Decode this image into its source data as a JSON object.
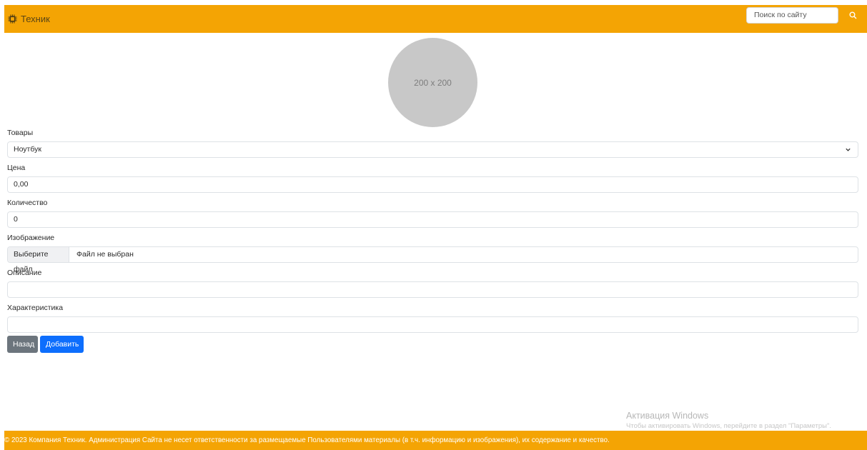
{
  "navbar": {
    "brand_label": "Техник",
    "search_placeholder": "Поиск по сайту",
    "accent_color": "#f4a404"
  },
  "avatar": {
    "placeholder_text": "200 x 200"
  },
  "form": {
    "products_label": "Товары",
    "products_value": "Ноутбук",
    "price_label": "Цена",
    "price_value": "0,00",
    "quantity_label": "Количество",
    "quantity_value": "0",
    "image_label": "Изображение",
    "file_button_label": "Выберите файл",
    "file_status": "Файл не выбран",
    "description_label": "Описание",
    "description_value": "",
    "specs_label": "Характеристика",
    "specs_value": ""
  },
  "actions": {
    "back_label": "Назад",
    "add_label": "Добавить"
  },
  "watermark": {
    "title": "Активация Windows",
    "subtitle": "Чтобы активировать Windows, перейдите в раздел \"Параметры\"."
  },
  "footer": {
    "text": "© 2023 Компания Техник. Администрация Сайта не несет ответственности за размещаемые Пользователями материалы (в т.ч. информацию и изображения), их содержание и качество."
  },
  "icons": {
    "brand": "chip-icon",
    "search": "search-icon",
    "select": "chevron-down-icon"
  }
}
